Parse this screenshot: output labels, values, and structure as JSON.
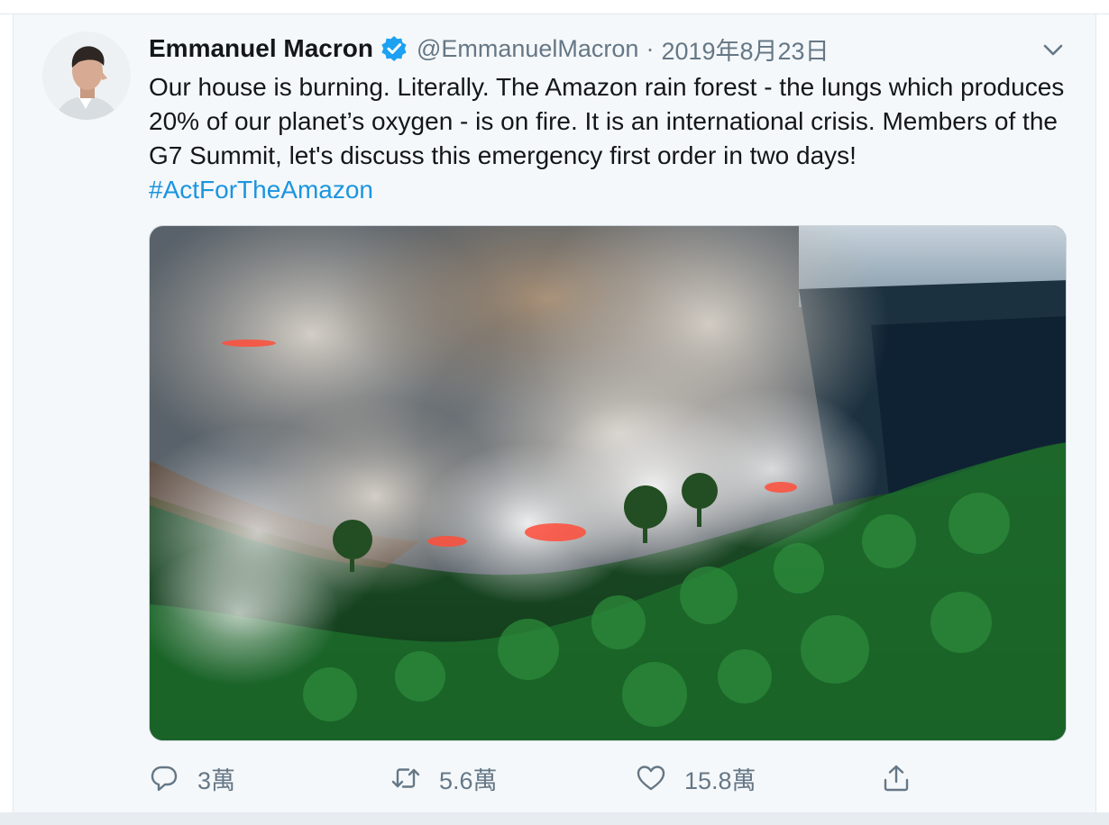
{
  "tweet": {
    "author_name": "Emmanuel Macron",
    "handle": "@EmmanuelMacron",
    "separator": "·",
    "date": "2019年8月23日",
    "text_main": "Our house is burning. Literally. The Amazon rain forest - the lungs which produces 20% of our planet’s oxygen - is on fire. It is an international crisis. Members of the G7 Summit, let's discuss this emergency first order in two days! ",
    "hashtag": "#ActForTheAmazon"
  },
  "actions": {
    "reply_count": "3萬",
    "retweet_count": "5.6萬",
    "like_count": "15.8萬"
  },
  "icons": {
    "verified": "verified-badge-icon",
    "caret": "chevron-down-icon",
    "reply": "reply-icon",
    "retweet": "retweet-icon",
    "like": "heart-icon",
    "share": "share-icon"
  },
  "colors": {
    "accent": "#1b95e0",
    "verified": "#1da1f2",
    "text": "#14171a",
    "muted": "#657786",
    "background": "#f5f8fa"
  }
}
